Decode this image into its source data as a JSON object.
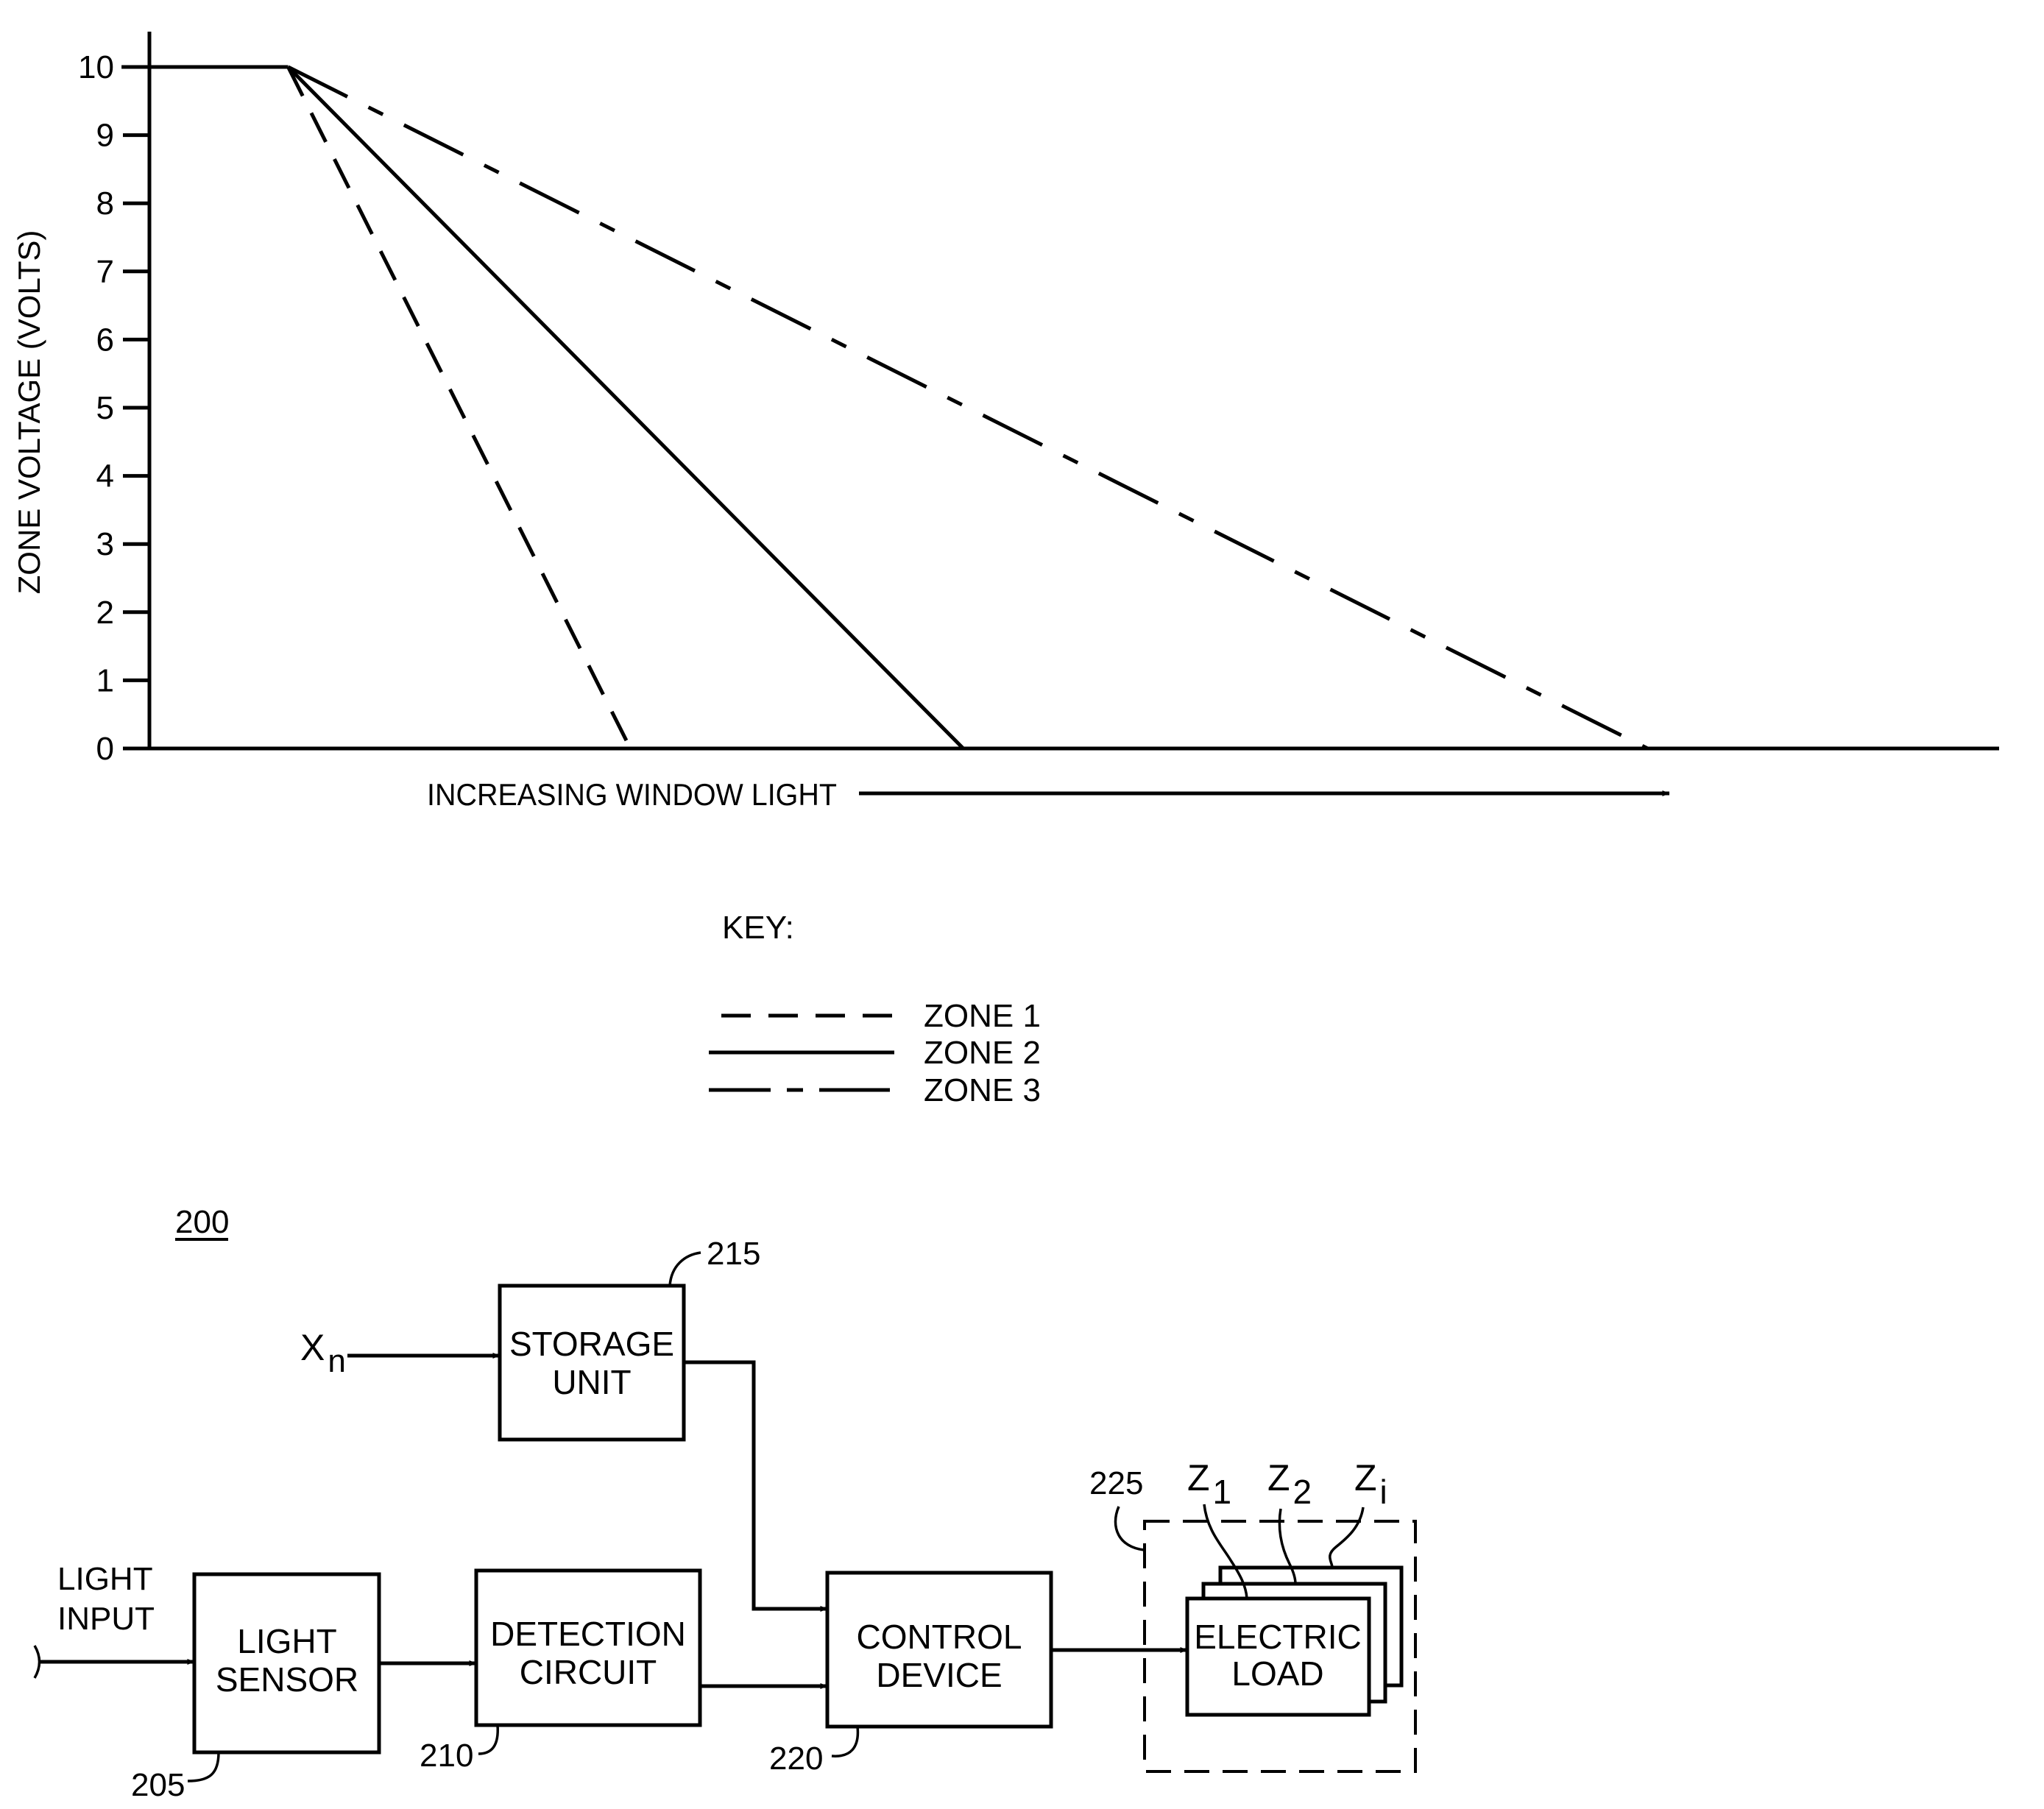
{
  "chart_data": {
    "type": "line",
    "title": "",
    "xlabel": "INCREASING WINDOW LIGHT",
    "ylabel": "ZONE VOLTAGE (VOLTS)",
    "xlim": [
      0,
      100
    ],
    "ylim": [
      0,
      10
    ],
    "x_units_note": "relative (no numeric x scale shown)",
    "yticks": [
      0,
      1,
      2,
      3,
      4,
      5,
      6,
      7,
      8,
      9,
      10
    ],
    "grid": false,
    "legend": {
      "title": "KEY:",
      "placement": "below-chart",
      "entries": [
        {
          "name": "ZONE 1",
          "style": "dashed"
        },
        {
          "name": "ZONE 2",
          "style": "solid"
        },
        {
          "name": "ZONE 3",
          "style": "dash-dot"
        }
      ]
    },
    "series": [
      {
        "name": "ZONE 1",
        "style": "dashed",
        "points": [
          [
            -1.5,
            10
          ],
          [
            7.5,
            10
          ],
          [
            26,
            0
          ]
        ]
      },
      {
        "name": "ZONE 2",
        "style": "solid",
        "points": [
          [
            -1.5,
            10
          ],
          [
            7.5,
            10
          ],
          [
            44,
            0
          ],
          [
            100,
            0
          ]
        ]
      },
      {
        "name": "ZONE 3",
        "style": "dash-dot",
        "points": [
          [
            -1.5,
            10
          ],
          [
            7.5,
            10
          ],
          [
            81,
            0
          ]
        ]
      }
    ]
  },
  "diagram": {
    "figure_ref": "200",
    "input_labels": {
      "xn_main": "X",
      "xn_sub": "n",
      "light_input_line1": "LIGHT",
      "light_input_line2": "INPUT"
    },
    "blocks": [
      {
        "id": "light-sensor",
        "line1": "LIGHT",
        "line2": "SENSOR",
        "ref": "205"
      },
      {
        "id": "detection-circuit",
        "line1": "DETECTION",
        "line2": "CIRCUIT",
        "ref": "210"
      },
      {
        "id": "storage-unit",
        "line1": "STORAGE",
        "line2": "UNIT",
        "ref": "215"
      },
      {
        "id": "control-device",
        "line1": "CONTROL",
        "line2": "DEVICE",
        "ref": "220"
      },
      {
        "id": "electric-load",
        "line1": "ELECTRIC",
        "line2": "LOAD",
        "ref": "225"
      }
    ],
    "zones": [
      {
        "main": "Z",
        "sub": "1"
      },
      {
        "main": "Z",
        "sub": "2"
      },
      {
        "main": "Z",
        "sub": "i"
      }
    ]
  }
}
